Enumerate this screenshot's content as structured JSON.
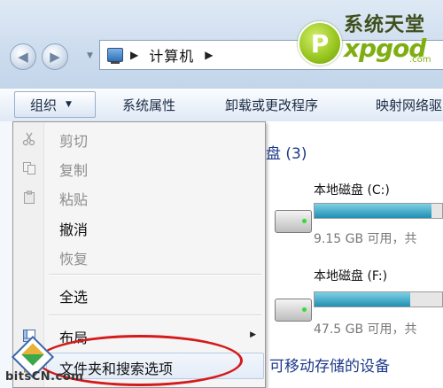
{
  "window": {
    "breadcrumb": "计算机"
  },
  "watermark": {
    "top_text": "系统天堂",
    "brand": "xpgod",
    "domain_suffix": ".com",
    "bottom_text": "bitsCN.com"
  },
  "toolbar": {
    "organize_label": "组织",
    "system_properties_label": "系统属性",
    "uninstall_label": "卸载或更改程序",
    "map_drive_label": "映射网络驱"
  },
  "menu": {
    "items": [
      {
        "label": "剪切",
        "enabled": false,
        "icon": "scissors-icon"
      },
      {
        "label": "复制",
        "enabled": false,
        "icon": "copy-icon"
      },
      {
        "label": "粘贴",
        "enabled": false,
        "icon": "paste-icon"
      },
      {
        "label": "撤消",
        "enabled": true
      },
      {
        "label": "恢复",
        "enabled": false
      },
      {
        "label": "全选",
        "enabled": true
      },
      {
        "label": "布局",
        "enabled": true,
        "icon": "layout-icon",
        "submenu": true
      },
      {
        "label": "文件夹和搜索选项",
        "enabled": true,
        "icon": "folder-options-icon",
        "highlighted": true
      }
    ]
  },
  "content": {
    "group_title": "盘 (3)",
    "drives": [
      {
        "name": "本地磁盘 (C:)",
        "free": "9.15 GB 可用，共",
        "used_fraction": 0.92
      },
      {
        "name": "本地磁盘 (F:)",
        "free": "47.5 GB 可用，共",
        "used_fraction": 0.75
      }
    ],
    "removable_title": "可移动存储的设备"
  },
  "colors": {
    "accent_blue": "#1e3a8a",
    "highlight_oval": "#d41b1b",
    "bar_fill": "#1f8fb3"
  }
}
